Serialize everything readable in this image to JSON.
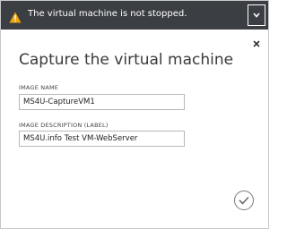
{
  "warning": {
    "message": "The virtual machine is not stopped.",
    "icon": "warning-triangle-icon",
    "color": "#f0a30a",
    "bar_color": "#3b3f44"
  },
  "dialog": {
    "title": "Capture the virtual machine",
    "image_name_label": "IMAGE NAME",
    "image_name_value": "MS4U-CaptureVM1",
    "image_description_label": "IMAGE DESCRIPTION (LABEL)",
    "image_description_value": "MS4U.info Test VM-WebServer",
    "close_icon": "close-icon",
    "expand_icon": "chevron-down-icon",
    "confirm_icon": "checkmark-icon"
  }
}
